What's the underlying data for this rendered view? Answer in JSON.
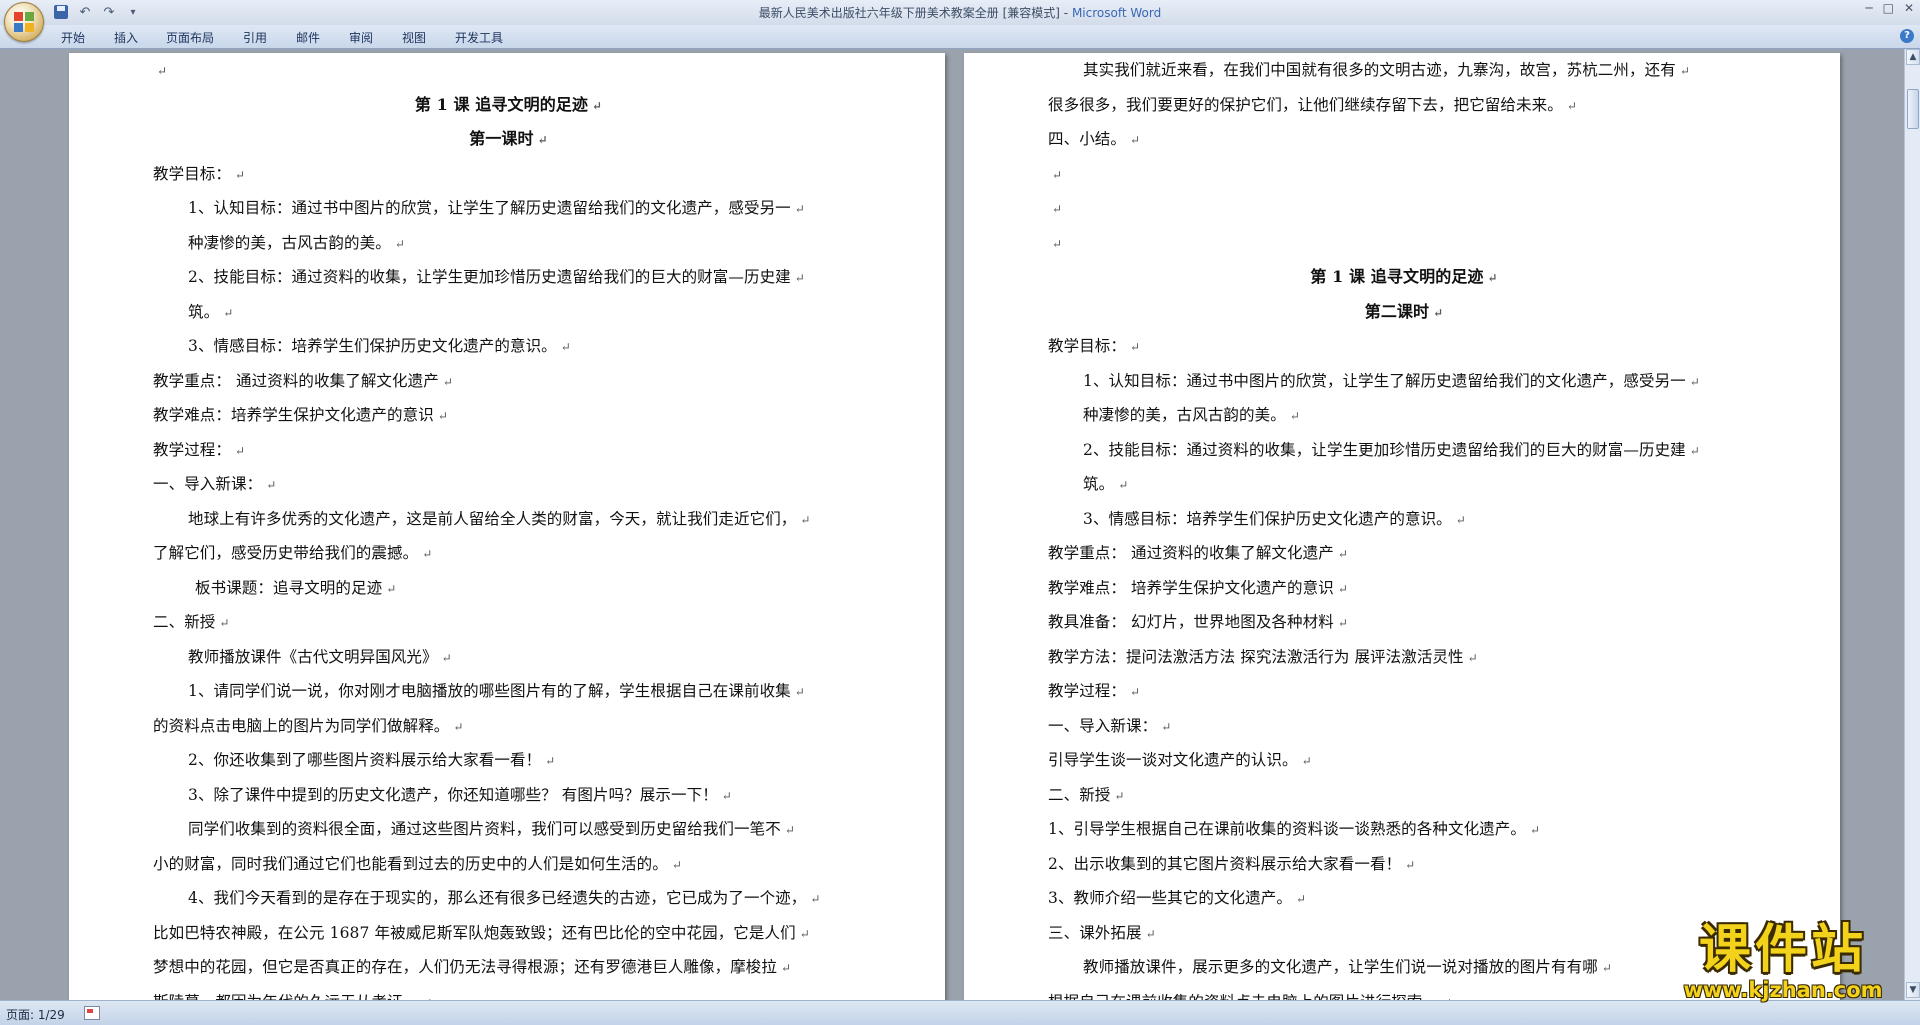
{
  "window": {
    "title": "最新人民美术出版社六年级下册美术教案全册 [兼容模式]",
    "app_name": "Microsoft Word",
    "sep": " - ",
    "controls": [
      "─",
      "□",
      "✕"
    ]
  },
  "quick_access": {
    "undo": "↶",
    "redo": "↷",
    "customize": "▾"
  },
  "ribbon": {
    "tabs": [
      "开始",
      "插入",
      "页面布局",
      "引用",
      "邮件",
      "审阅",
      "视图",
      "开发工具"
    ],
    "help": "?"
  },
  "page1": {
    "lines": [
      {
        "t": "",
        "s": "left"
      },
      {
        "t": "第 1 课    追寻文明的足迹",
        "s": "center"
      },
      {
        "t": "第一课时",
        "s": "center"
      },
      {
        "t": "教学目标：",
        "s": "left"
      },
      {
        "t": "1、认知目标：通过书中图片的欣赏，让学生了解历史遗留给我们的文化遗产，感受另一",
        "s": "ind1"
      },
      {
        "t": "种凄惨的美，古风古韵的美。",
        "s": "ind1"
      },
      {
        "t": "2、技能目标：通过资料的收集，让学生更加珍惜历史遗留给我们的巨大的财富—历史建",
        "s": "ind1"
      },
      {
        "t": "筑。",
        "s": "ind1"
      },
      {
        "t": "3、情感目标：培养学生们保护历史文化遗产的意识。",
        "s": "ind1"
      },
      {
        "t": "教学重点： 通过资料的收集了解文化遗产",
        "s": "left"
      },
      {
        "t": "教学难点：培养学生保护文化遗产的意识",
        "s": "left"
      },
      {
        "t": "教学过程：",
        "s": "left"
      },
      {
        "t": "一、导入新课：",
        "s": "left"
      },
      {
        "t": "地球上有许多优秀的文化遗产，这是前人留给全人类的财富，今天，就让我们走近它们，",
        "s": "ind1"
      },
      {
        "t": "了解它们，感受历史带给我们的震撼。",
        "s": "left"
      },
      {
        "t": "板书课题：追寻文明的足迹",
        "s": "ind2"
      },
      {
        "t": "二、新授",
        "s": "left"
      },
      {
        "t": "教师播放课件《古代文明异国风光》",
        "s": "ind1"
      },
      {
        "t": "1、请同学们说一说，你对刚才电脑播放的哪些图片有的了解，学生根据自己在课前收集",
        "s": "ind1"
      },
      {
        "t": "的资料点击电脑上的图片为同学们做解释。",
        "s": "left"
      },
      {
        "t": "2、你还收集到了哪些图片资料展示给大家看一看！",
        "s": "ind1"
      },
      {
        "t": "3、除了课件中提到的历史文化遗产，你还知道哪些？ 有图片吗？展示一下！",
        "s": "ind1"
      },
      {
        "t": "同学们收集到的资料很全面，通过这些图片资料，我们可以感受到历史留给我们一笔不",
        "s": "ind1"
      },
      {
        "t": "小的财富，同时我们通过它们也能看到过去的历史中的人们是如何生活的。",
        "s": "left"
      },
      {
        "t": "4、我们今天看到的是存在于现实的，那么还有很多已经遗失的古迹，它已成为了一个迹，",
        "s": "ind1"
      },
      {
        "t": "比如巴特农神殿，在公元 1687 年被威尼斯军队炮轰致毁；还有巴比伦的空中花园，它是人们",
        "s": "left"
      },
      {
        "t": "梦想中的花园，但它是否真正的存在，人们仍无法寻得根源；还有罗德港巨人雕像，摩梭拉",
        "s": "left"
      },
      {
        "t": "斯陵墓，都因为年代的久远无从考证。",
        "s": "left"
      }
    ]
  },
  "page2": {
    "lines": [
      {
        "t": "其实我们就近来看，在我们中国就有很多的文明古迹，九寨沟，故宫，苏杭二州，还有",
        "s": "ind1"
      },
      {
        "t": "很多很多，我们要更好的保护它们，让他们继续存留下去，把它留给未来。",
        "s": "left"
      },
      {
        "t": "四、小结。",
        "s": "left"
      },
      {
        "t": "",
        "s": "left"
      },
      {
        "t": "",
        "s": "left"
      },
      {
        "t": "",
        "s": "left"
      },
      {
        "t": "第 1 课    追寻文明的足迹",
        "s": "center"
      },
      {
        "t": "第二课时",
        "s": "center"
      },
      {
        "t": "教学目标：",
        "s": "left"
      },
      {
        "t": "1、认知目标：通过书中图片的欣赏，让学生了解历史遗留给我们的文化遗产，感受另一",
        "s": "ind1"
      },
      {
        "t": "种凄惨的美，古风古韵的美。",
        "s": "ind1"
      },
      {
        "t": "2、技能目标：通过资料的收集，让学生更加珍惜历史遗留给我们的巨大的财富—历史建",
        "s": "ind1"
      },
      {
        "t": "筑。",
        "s": "ind1"
      },
      {
        "t": "3、情感目标：培养学生们保护历史文化遗产的意识。",
        "s": "ind1"
      },
      {
        "t": "教学重点： 通过资料的收集了解文化遗产",
        "s": "left"
      },
      {
        "t": "教学难点： 培养学生保护文化遗产的意识",
        "s": "left"
      },
      {
        "t": "教具准备： 幻灯片，世界地图及各种材料",
        "s": "left"
      },
      {
        "t": "教学方法：提问法激活方法     探究法激活行为     展评法激活灵性",
        "s": "left"
      },
      {
        "t": "教学过程：",
        "s": "left"
      },
      {
        "t": "一、导入新课：",
        "s": "left"
      },
      {
        "t": "引导学生谈一谈对文化遗产的认识。",
        "s": "left"
      },
      {
        "t": "二、新授",
        "s": "left"
      },
      {
        "t": "1、引导学生根据自己在课前收集的资料谈一谈熟悉的各种文化遗产。",
        "s": "left"
      },
      {
        "t": "2、出示收集到的其它图片资料展示给大家看一看！",
        "s": "left"
      },
      {
        "t": "3、教师介绍一些其它的文化遗产。",
        "s": "left"
      },
      {
        "t": "三、课外拓展",
        "s": "left"
      },
      {
        "t": "教师播放课件，展示更多的文化遗产，让学生们说一说对播放的图片有有哪",
        "s": "ind1"
      },
      {
        "t": "根据自己在课前收集的资料点击电脑上的图片进行探索。",
        "s": "left"
      }
    ]
  },
  "mark_char": "↵",
  "scroll": {
    "up": "▲",
    "down": "▼"
  },
  "watermark": {
    "main": "课件站",
    "url": "www.kjzhan.com"
  },
  "status": {
    "page": "页面: 1/29"
  }
}
